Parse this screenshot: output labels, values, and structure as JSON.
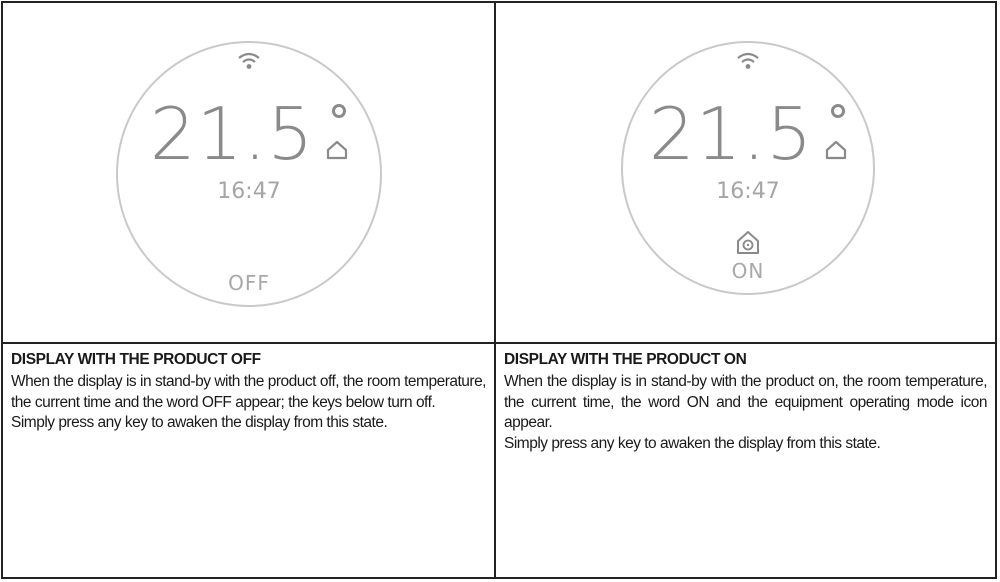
{
  "left_panel": {
    "display": {
      "temperature": "21.5",
      "time": "16:47",
      "state_label": "OFF"
    },
    "heading": "DISPLAY WITH THE PRODUCT OFF",
    "paragraphs": [
      "When the display is in stand-by with the product off, the room temperature, the current time and the word OFF appear; the keys below turn off.",
      "Simply press any key to awaken the display from this state."
    ]
  },
  "right_panel": {
    "display": {
      "temperature": "21.5",
      "time": "16:47",
      "state_label": "ON",
      "mode_icon": "home-mode-icon"
    },
    "heading": "DISPLAY WITH THE PRODUCT ON",
    "paragraphs": [
      "When the display is in stand-by with the product on, the room temperature, the current time, the word ON and the equipment operating mode icon appear.",
      "Simply press any key to awaken the display from this state."
    ]
  },
  "colors": {
    "border": "#222222",
    "dial_ring": "#c9c9c9",
    "display_text": "#8a8a8a"
  }
}
